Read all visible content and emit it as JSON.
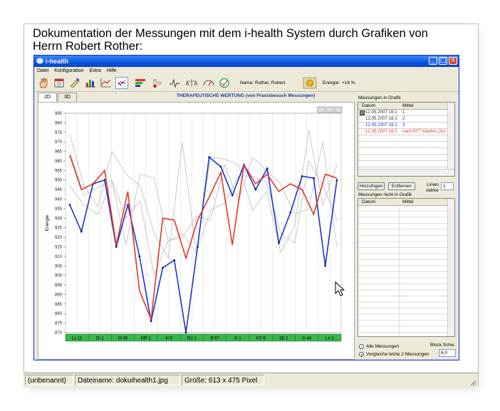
{
  "heading": "Dokumentation der Messungen mit dem i-health System durch Grafiken von Herrn Robert Rother:",
  "window": {
    "title": "i-health",
    "menu": [
      "Datei",
      "Konfiguration",
      "Extra",
      "Hilfe"
    ],
    "name_label": "Name:",
    "name_value": "Rother, Robert",
    "energy_label": "Energie:",
    "energy_value": "+16 %",
    "tabs": [
      "2D",
      "3D"
    ],
    "active_tab": "2D"
  },
  "chart_data": {
    "type": "line",
    "title": "THERAPEUTISCHE WERTUNG (von Praxisbesuch Messungen)",
    "ylabel": "Energie",
    "xlabel": "",
    "ylim": [
      870,
      985
    ],
    "yticks": [
      870,
      875,
      880,
      885,
      890,
      895,
      900,
      905,
      910,
      915,
      920,
      925,
      930,
      935,
      940,
      945,
      950,
      955,
      960,
      965,
      970,
      975,
      980,
      985
    ],
    "categories": [
      "Lu 11",
      "Di 1",
      "M 45",
      "MP 1",
      "H 9",
      "Dü 1",
      "B 67",
      "N 1",
      "KS 9",
      "3E 1",
      "G 44",
      "Le 1"
    ],
    "legend_position": "none",
    "grid": true,
    "series": [
      {
        "color": "#c8c8c8",
        "values": [
          974,
          947,
          936,
          965,
          953,
          947,
          922,
          909,
          970,
          911,
          962,
          961,
          958,
          934,
          944,
          912,
          926,
          976,
          937,
          958
        ]
      },
      {
        "color": "#c8c8c8",
        "values": [
          947,
          937,
          932,
          949,
          916,
          953,
          951,
          918,
          920,
          931,
          929,
          958,
          939,
          962,
          955,
          948,
          932,
          935,
          970,
          915
        ]
      },
      {
        "color": "#c8c8c8",
        "values": [
          965,
          942,
          946,
          950,
          930,
          939,
          900,
          918,
          922,
          912,
          934,
          938,
          952,
          952,
          949,
          922,
          917,
          960,
          947,
          929
        ]
      },
      {
        "color": "#1c34c8",
        "values": [
          937,
          923,
          948,
          950,
          915,
          937,
          910,
          876,
          904,
          908,
          870,
          915,
          962,
          957,
          942,
          958,
          945,
          956,
          917,
          933,
          952,
          951,
          905,
          950
        ]
      },
      {
        "color": "#e0362c",
        "values": [
          963,
          945,
          948,
          955,
          916,
          944,
          892,
          877,
          930,
          929,
          909,
          929,
          941,
          954,
          916,
          958,
          948,
          953,
          944,
          948,
          945,
          932,
          953,
          951
        ]
      }
    ]
  },
  "panel": {
    "grid1_title": "Messungen in Grafik",
    "grid1_headers": [
      "Datum",
      "Mittel"
    ],
    "grid1_rows": [
      {
        "datum": "12.05.2007 16:1",
        "mittel": "1",
        "color": "#333333",
        "checkbox": true
      },
      {
        "datum": "12.05.2007 16:1",
        "mittel": "2",
        "color": "#333333",
        "checkbox": false
      },
      {
        "datum": "12.05.2007 16:1",
        "mittel": "3",
        "color": "#1c34c8",
        "checkbox": false
      },
      {
        "datum": "12.05.2007 16:2",
        "mittel": "nach EFT klopfen (3x)",
        "color": "#e0362c",
        "checkbox": false
      }
    ],
    "btn_add": "Hinzufügen",
    "btn_remove": "Entfernen",
    "linien_label": "Linien",
    "staerke_label": "stärke",
    "linien_value": "1",
    "grid2_title": "Messungen nicht in Grafik",
    "grid2_headers": [
      "Datum",
      "Mittel"
    ],
    "radio_all": "Alle Messungen",
    "radio_compare": "Vergleiche letzte 2 Messungen",
    "block_label": "Block.Schw.",
    "block_value": "6,0"
  },
  "statusbar": {
    "name": "(unbenannt)",
    "file": "Dateiname: dokuihealth1.jpg",
    "size": "Größe: 613 x 475 Pixel"
  }
}
